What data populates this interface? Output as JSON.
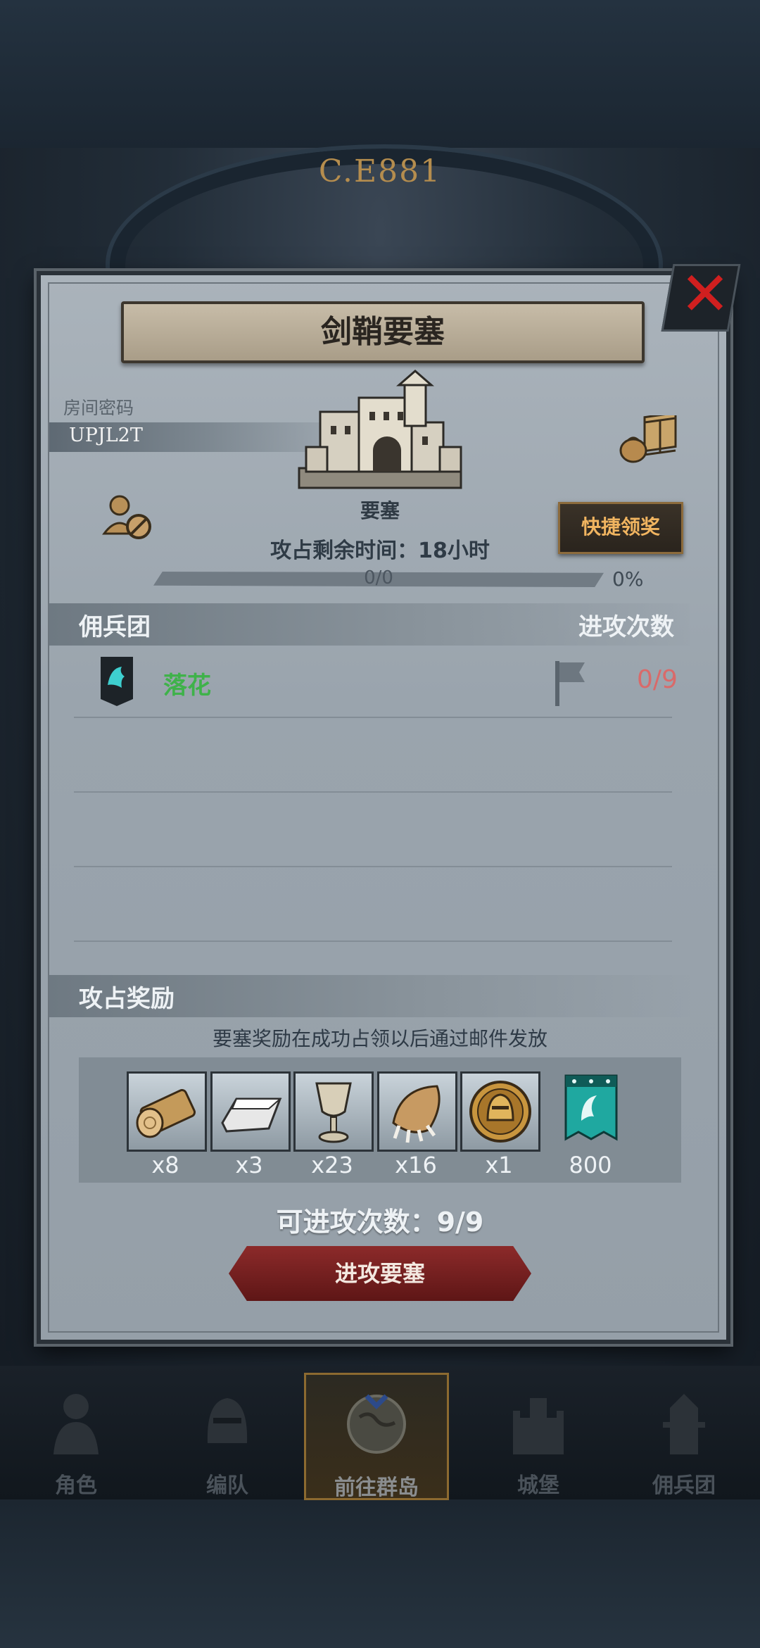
{
  "background": {
    "year": "C.E881"
  },
  "modal": {
    "title": "剑鞘要塞",
    "room_label": "房间密码",
    "room_code": "UPJL2T",
    "castle_label": "要塞",
    "quick_claim": "快捷领奖",
    "remaining_time": "攻占剩余时间：18小时",
    "progress_text": "0/0",
    "progress_percent": "0%",
    "guild_section": {
      "left": "佣兵团",
      "right": "进攻次数"
    },
    "guild_rows": [
      {
        "name": "落花",
        "count": "0/9"
      }
    ],
    "reward_section": "攻占奖励",
    "reward_note": "要塞奖励在成功占领以后通过邮件发放",
    "rewards": [
      {
        "icon": "wood-log-icon",
        "qty": "x8"
      },
      {
        "icon": "iron-ingot-icon",
        "qty": "x3"
      },
      {
        "icon": "goblet-icon",
        "qty": "x23"
      },
      {
        "icon": "beast-claw-icon",
        "qty": "x16"
      },
      {
        "icon": "knight-helmet-coin-icon",
        "qty": "x1"
      },
      {
        "icon": "guild-banner-icon",
        "qty": "800"
      }
    ],
    "attempts": "可进攻次数：9/9",
    "attack_button": "进攻要塞"
  },
  "nav": [
    {
      "label": "角色",
      "icon": "knight-icon"
    },
    {
      "label": "编队",
      "icon": "helmet-icon"
    },
    {
      "label": "前往群岛",
      "icon": "globe-icon",
      "active": true
    },
    {
      "label": "城堡",
      "icon": "castle-icon"
    },
    {
      "label": "佣兵团",
      "icon": "mercenary-icon"
    }
  ],
  "colors": {
    "modal_bg": "#9aa4ad",
    "guild_name": "#3fb24a",
    "attack_count": "#d96a6a",
    "quick_claim_text": "#f0b460",
    "attack_button": "#8c2a2a",
    "close_x": "#d01f1f"
  }
}
